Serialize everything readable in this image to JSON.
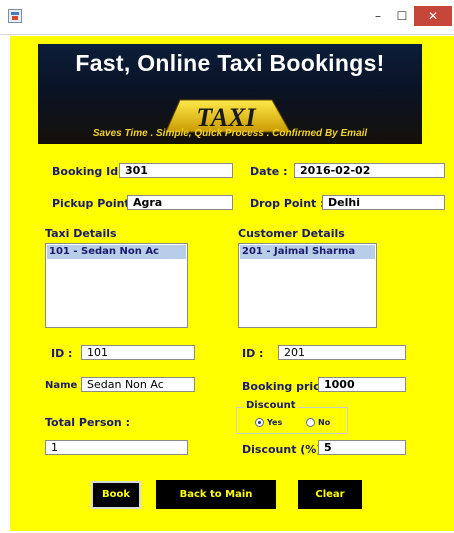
{
  "window": {
    "minimize_glyph": "–",
    "maximize_glyph": "☐",
    "close_glyph": "✕"
  },
  "banner": {
    "title": "Fast, Online Taxi Bookings!",
    "sign_text": "TAXI",
    "subtitle": "Saves Time . Simple, Quick Process . Confirmed By Email"
  },
  "form": {
    "booking_id": {
      "label": "Booking Id :",
      "value": "301"
    },
    "date": {
      "label": "Date :",
      "value": "2016-02-02"
    },
    "pickup": {
      "label": "Pickup Point :",
      "value": "Agra"
    },
    "drop": {
      "label": "Drop Point :",
      "value": "Delhi"
    }
  },
  "taxi": {
    "header": "Taxi Details",
    "items": [
      "101 - Sedan Non Ac"
    ],
    "id_label": "ID :",
    "id_value": "101",
    "name_label": "Name :",
    "name_value": "Sedan Non Ac"
  },
  "customer": {
    "header": "Customer Details",
    "items": [
      "201 - Jaimal Sharma"
    ],
    "id_label": "ID :",
    "id_value": "201"
  },
  "pricing": {
    "booking_price_label": "Booking price:",
    "booking_price_value": "1000",
    "total_person_label": "Total Person :",
    "total_person_value": "1",
    "discount_group_title": "Discount",
    "discount_yes": "Yes",
    "discount_no": "No",
    "discount_selected": "Yes",
    "discount_pct_label": "Discount (%):",
    "discount_pct_value": "5"
  },
  "buttons": {
    "book": "Book",
    "back": "Back to Main",
    "clear": "Clear"
  },
  "colors": {
    "panel": "#ffff00",
    "label": "#1a1a6e",
    "button_bg": "#000000",
    "button_text": "#ffff00",
    "close_button": "#c7463a"
  }
}
